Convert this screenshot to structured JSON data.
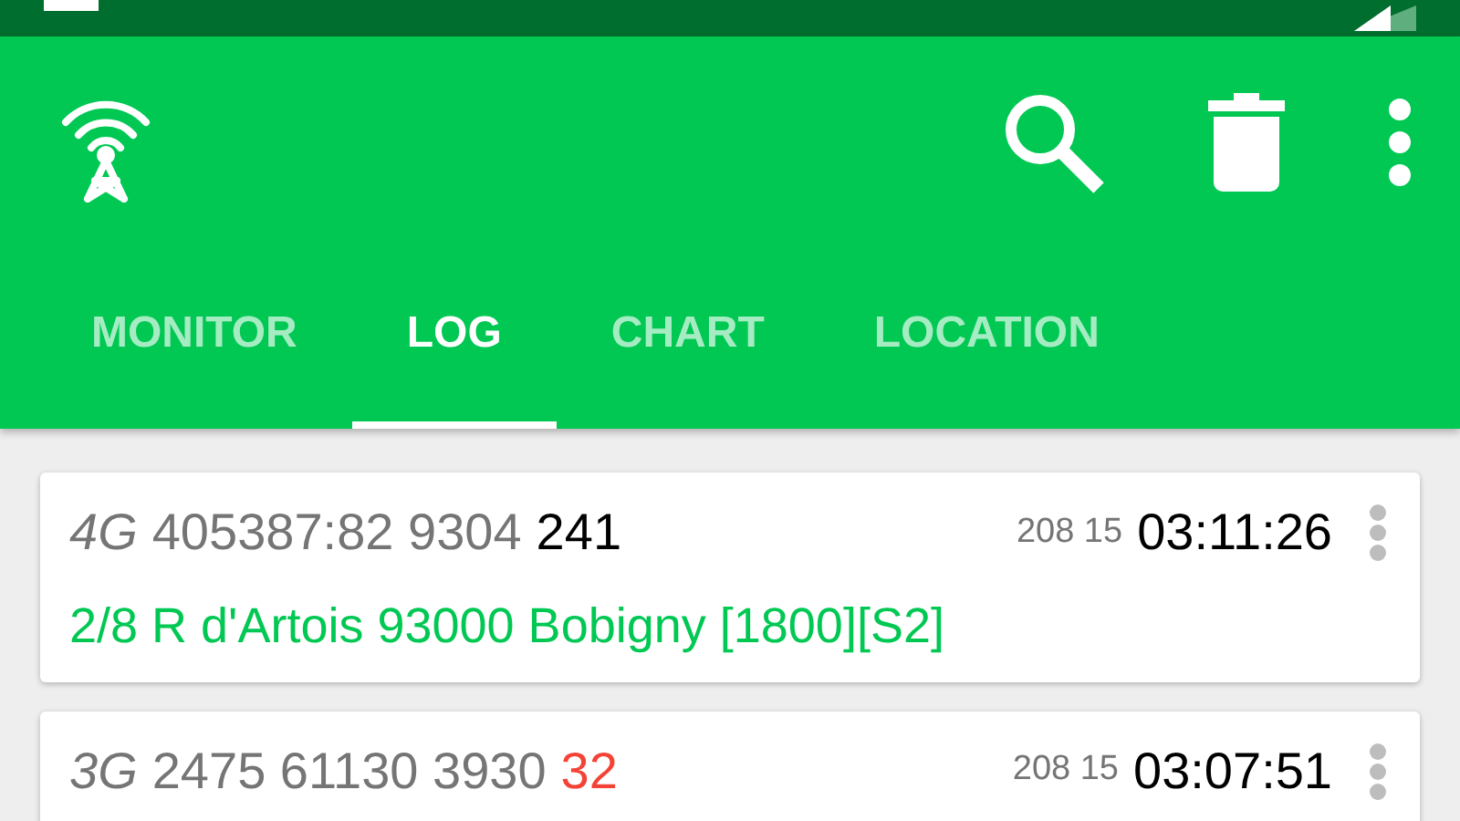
{
  "tabs": [
    {
      "label": "MONITOR",
      "selected": false
    },
    {
      "label": "LOG",
      "selected": true
    },
    {
      "label": "CHART",
      "selected": false
    },
    {
      "label": "LOCATION",
      "selected": false
    }
  ],
  "log": [
    {
      "tech": "4G",
      "cell": "405387:82 9304",
      "signal": "241",
      "color": "#000000",
      "network": "208 15",
      "time": "03:11:26",
      "address": "2/8 R d'Artois 93000 Bobigny [1800][S2]"
    },
    {
      "tech": "3G",
      "cell": "2475 61130 3930",
      "signal": "32",
      "color": "#f44336",
      "network": "208 15",
      "time": "03:07:51"
    }
  ]
}
